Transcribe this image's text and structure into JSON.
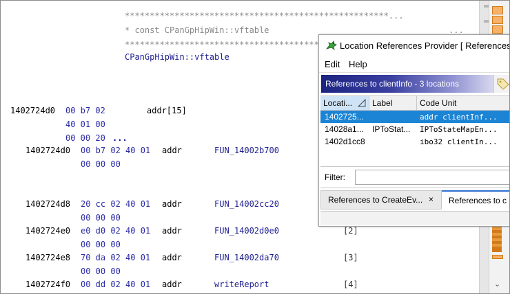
{
  "listing": {
    "comment_stars_1": "*****************************************************...",
    "comment_text": "* const CPanGpHipWin::vftable",
    "comment_ellipsis": "...",
    "comment_stars_2": "*******************************************",
    "label": "CPanGpHipWin::vftable",
    "row0": {
      "address": "1402724d0",
      "bytes": [
        "00 b7 02",
        "40 01 00",
        "00 00 20"
      ],
      "more": "...",
      "operand": "addr[15]"
    },
    "rows": [
      {
        "address": "1402724d0",
        "bytes": "00 b7 02 40 01",
        "mnemonic": "addr",
        "operand": "FUN_14002b700",
        "bytes2": "00 00 00",
        "index": ""
      },
      {
        "address": "1402724d8",
        "bytes": "20 cc 02 40 01",
        "mnemonic": "addr",
        "operand": "FUN_14002cc20",
        "bytes2": "00 00 00",
        "index": ""
      },
      {
        "address": "1402724e0",
        "bytes": "e0 d0 02 40 01",
        "mnemonic": "addr",
        "operand": "FUN_14002d0e0",
        "bytes2": "00 00 00",
        "index": "[2]"
      },
      {
        "address": "1402724e8",
        "bytes": "70 da 02 40 01",
        "mnemonic": "addr",
        "operand": "FUN_14002da70",
        "bytes2": "00 00 00",
        "index": "[3]"
      },
      {
        "address": "1402724f0",
        "bytes": "00 dd 02 40 01",
        "mnemonic": "addr",
        "operand": "writeReport",
        "bytes2": "",
        "index": "[4]"
      }
    ]
  },
  "provider": {
    "title": "Location References Provider [ References ...",
    "menu": [
      "Edit",
      "Help"
    ],
    "header": "References to clientInfo - 3 locations",
    "columns": [
      "Locati...",
      "Label",
      "Code Unit"
    ],
    "rows": [
      {
        "location": "1402725...",
        "label": "",
        "code_unit": "addr clientInf..."
      },
      {
        "location": "14028a1...",
        "label": "IPToStat...",
        "code_unit": "IPToStateMapEn..."
      },
      {
        "location": "1402d1cc8",
        "label": "",
        "code_unit": "ibo32 clientIn..."
      }
    ],
    "filter_label": "Filter:",
    "filter_value": "",
    "tabs": [
      {
        "label": "References to CreateEv...",
        "close": "×"
      },
      {
        "label": "References to c"
      }
    ]
  },
  "icons": {
    "provider": "dragon-icon",
    "tag": "tag-icon",
    "sort": "sort-icon",
    "scroll_down": "chevron-down-icon"
  },
  "colors": {
    "header_start": "#1c2380",
    "selection": "#1c84d4",
    "marker": "#e89a3c"
  }
}
